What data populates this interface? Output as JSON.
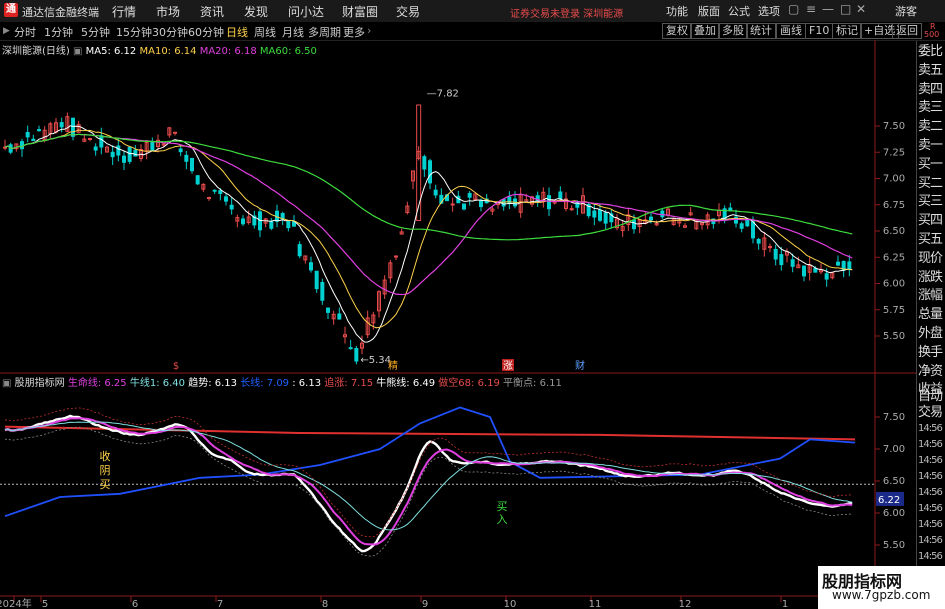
{
  "titlebar": {
    "app_name": "通达信金融终端",
    "menus": [
      "行情",
      "市场",
      "资讯",
      "发现",
      "问小达",
      "财富圈",
      "交易"
    ],
    "notice": "证券交易未登录  深圳能源",
    "right_menus": [
      "功能",
      "版面",
      "公式",
      "选项"
    ],
    "visitor": "游客"
  },
  "toolbar": {
    "periods": [
      "分时",
      "1分钟",
      "5分钟",
      "15分钟",
      "30分钟",
      "60分钟",
      "日线",
      "周线",
      "月线",
      "多周期",
      "更多"
    ],
    "selected": "日线",
    "right_buttons": [
      "复权",
      "叠加",
      "多股",
      "统计",
      "画线",
      "F10",
      "标记",
      "+自选",
      "返回"
    ]
  },
  "main_chart": {
    "legend_name": "深圳能源(日线)",
    "ma": [
      {
        "label": "MA5: 6.12",
        "color": "#ffffff"
      },
      {
        "label": "MA10: 6.14",
        "color": "#ffd24a"
      },
      {
        "label": "MA20: 6.18",
        "color": "#e040e0"
      },
      {
        "label": "MA60: 6.50",
        "color": "#3ddc3d"
      }
    ],
    "y_ticks": [
      "7.50",
      "7.25",
      "7.00",
      "6.75",
      "6.50",
      "6.25",
      "6.00",
      "5.75",
      "5.50"
    ],
    "high_label": "7.82",
    "low_label": "5.34",
    "markers": [
      {
        "text": "$",
        "color": "#e84b4b"
      },
      {
        "text": "精",
        "color": "#ffb020"
      },
      {
        "text": "涨",
        "color": "#ffffff",
        "bg": "#c02020"
      },
      {
        "text": "财",
        "color": "#5aa0ff"
      }
    ]
  },
  "indicator": {
    "name": "股朋指标网",
    "items": [
      {
        "label": "生命线: 6.25",
        "color": "#e040e0"
      },
      {
        "label": "牛线1: 6.40",
        "color": "#7fe0e0"
      },
      {
        "label": "趋势: 6.13",
        "color": "#ffffff"
      },
      {
        "label": "长线: 7.09",
        "color": "#2060ff"
      },
      {
        "label": ": 6.13",
        "color": "#ffffff"
      },
      {
        "label": "追涨: 7.15",
        "color": "#e84b4b"
      },
      {
        "label": "牛熊线: 6.49",
        "color": "#ffffff"
      },
      {
        "label": "做空68: 6.19",
        "color": "#e84b4b"
      },
      {
        "label": "平衡点: 6.11",
        "color": "#999999"
      }
    ],
    "y_ticks": [
      "7.50",
      "7.00",
      "6.50",
      "6.00",
      "5.50"
    ],
    "current_value": "6.22",
    "annotations": [
      {
        "text": "收\n阴\n买",
        "color": "#ffd24a"
      },
      {
        "text": "买\n入",
        "color": "#3ddc3d"
      }
    ]
  },
  "x_axis": [
    "2024年",
    "5",
    "6",
    "7",
    "8",
    "9",
    "10",
    "11",
    "12",
    "1"
  ],
  "right_panel": {
    "top_label": "R",
    "top_value": "500",
    "items": [
      "委比",
      "卖五",
      "卖四",
      "卖三",
      "卖二",
      "卖一",
      "买一",
      "买二",
      "买三",
      "买四",
      "买五",
      "现价",
      "涨跌",
      "涨幅",
      "总量",
      "外盘",
      "换手",
      "净资",
      "收益"
    ],
    "bottom_items": [
      "自动",
      "交易",
      "14:56",
      "14:56",
      "14:56",
      "14:56",
      "14:56",
      "14:56",
      "14:56",
      "14:56",
      "14:56"
    ]
  },
  "watermark": {
    "line1": "股朋指标网",
    "line2": "www.7gpzb.com"
  },
  "colors": {
    "up": "#e84b4b",
    "down": "#00d0d0",
    "ma5": "#ffffff",
    "ma10": "#ffd24a",
    "ma20": "#e040e0",
    "ma60": "#3ddc3d"
  }
}
